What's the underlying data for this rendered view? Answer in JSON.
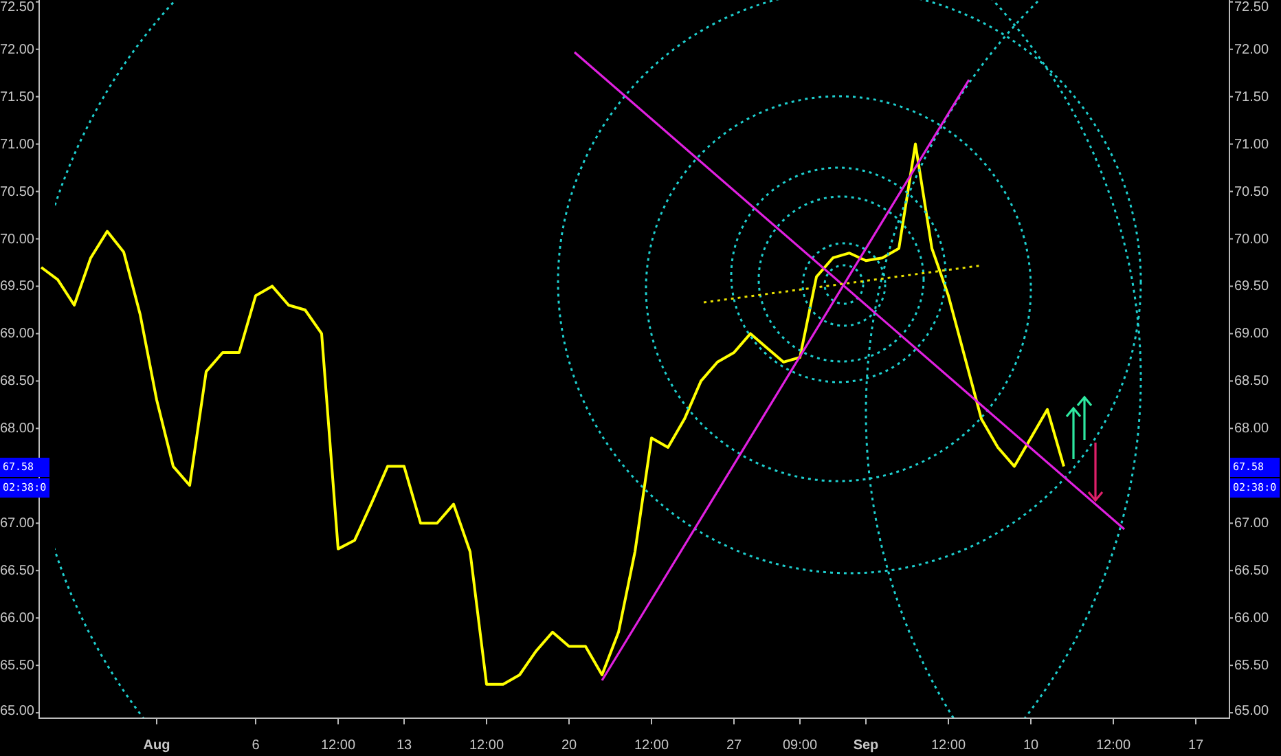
{
  "chart": {
    "chart_data": {
      "type": "line",
      "ylim": [
        64.95,
        72.52
      ],
      "categories": [
        null,
        null,
        null,
        null,
        null,
        null,
        null,
        "Aug",
        null,
        null,
        null,
        null,
        null,
        "6",
        null,
        null,
        null,
        null,
        "12:00",
        null,
        null,
        null,
        "13",
        null,
        null,
        null,
        null,
        "12:00",
        null,
        null,
        null,
        null,
        "20",
        null,
        null,
        null,
        null,
        "12:00",
        null,
        null,
        null,
        null,
        "27",
        null,
        null,
        null,
        "09:00",
        null,
        null,
        null,
        "Sep",
        null,
        null,
        null,
        null,
        "12:00",
        null,
        null,
        null,
        null,
        "10",
        null,
        null,
        null,
        null,
        "12:00",
        null,
        null,
        null,
        null,
        "17",
        null,
        null
      ],
      "series": [
        {
          "color": "#ffff00",
          "values": [
            69.7,
            69.57,
            69.3,
            69.8,
            70.08,
            69.86,
            69.2,
            68.3,
            67.6,
            67.4,
            68.6,
            68.8,
            68.8,
            69.4,
            69.5,
            69.3,
            69.25,
            69.0,
            66.73,
            66.82,
            67.2,
            67.6,
            67.6,
            67.0,
            67.0,
            67.2,
            66.7,
            65.3,
            65.3,
            65.4,
            65.65,
            65.85,
            65.7,
            65.7,
            65.4,
            65.85,
            66.7,
            67.9,
            67.8,
            68.1,
            68.5,
            68.7,
            68.8,
            69.0,
            68.85,
            68.7,
            68.75,
            69.6,
            69.8,
            69.85,
            69.77,
            69.8,
            69.9,
            71.0,
            69.9,
            69.4,
            68.75,
            68.1,
            67.8,
            67.6,
            67.9,
            68.2,
            67.6,
            null,
            null,
            null,
            null,
            null,
            null,
            null,
            null,
            null,
            null
          ]
        }
      ],
      "yticks": [
        {
          "value": 65,
          "label": "65.00"
        },
        {
          "value": 65.5,
          "label": "65.50"
        },
        {
          "value": 66,
          "label": "66.00"
        },
        {
          "value": 66.5,
          "label": "66.50"
        },
        {
          "value": 67,
          "label": "67.00"
        },
        {
          "value": 68,
          "label": "68.00"
        },
        {
          "value": 68.5,
          "label": "68.50"
        },
        {
          "value": 69,
          "label": "69.00"
        },
        {
          "value": 69.5,
          "label": "69.50"
        },
        {
          "value": 70,
          "label": "70.00"
        },
        {
          "value": 70.5,
          "label": "70.50"
        },
        {
          "value": 71,
          "label": "71.00"
        },
        {
          "value": 71.5,
          "label": "71.50"
        },
        {
          "value": 72,
          "label": "72.00"
        },
        {
          "value": 72.5,
          "label": "72.50"
        }
      ]
    }
  },
  "price_tags": [
    {
      "price": "67.58",
      "time": "02:38:0"
    },
    {
      "price": "67.58",
      "time": "02:38:0"
    }
  ]
}
